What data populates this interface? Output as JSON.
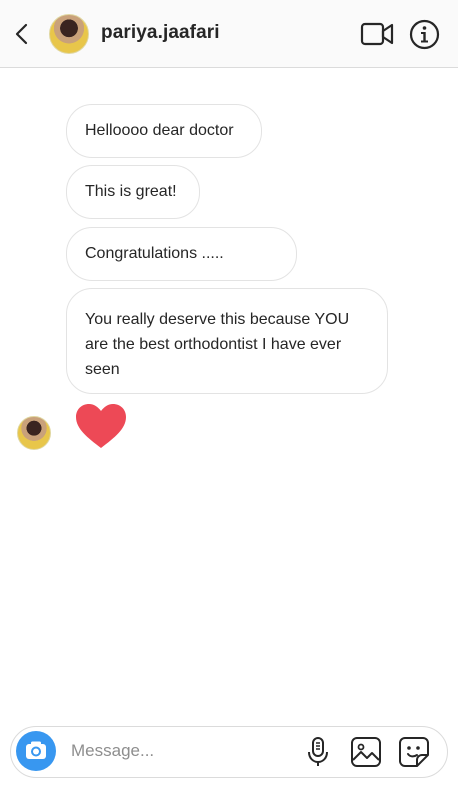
{
  "header": {
    "username": "pariya.jaafari",
    "icons": [
      "chevron-left-icon",
      "avatar",
      "video-call-icon",
      "info-icon"
    ]
  },
  "messages": [
    {
      "sender": "pariya.jaafari",
      "text": "Helloooo dear doctor"
    },
    {
      "sender": "pariya.jaafari",
      "text": "This is great!"
    },
    {
      "sender": "pariya.jaafari",
      "text": "Congratulations ....."
    },
    {
      "sender": "pariya.jaafari",
      "text": "You really deserve this because YOU are the best orthodontist I have ever seen"
    },
    {
      "sender": "pariya.jaafari",
      "emoji": "heart-icon"
    }
  ],
  "composer": {
    "placeholder": "Message...",
    "icons": [
      "camera-icon",
      "microphone-icon",
      "gallery-icon",
      "sticker-icon"
    ]
  },
  "colors": {
    "accent": "#3897f0",
    "heart": "#ed4956",
    "bubble_border": "#e3e3e3",
    "text": "#262626",
    "placeholder": "#8e8e8e"
  }
}
